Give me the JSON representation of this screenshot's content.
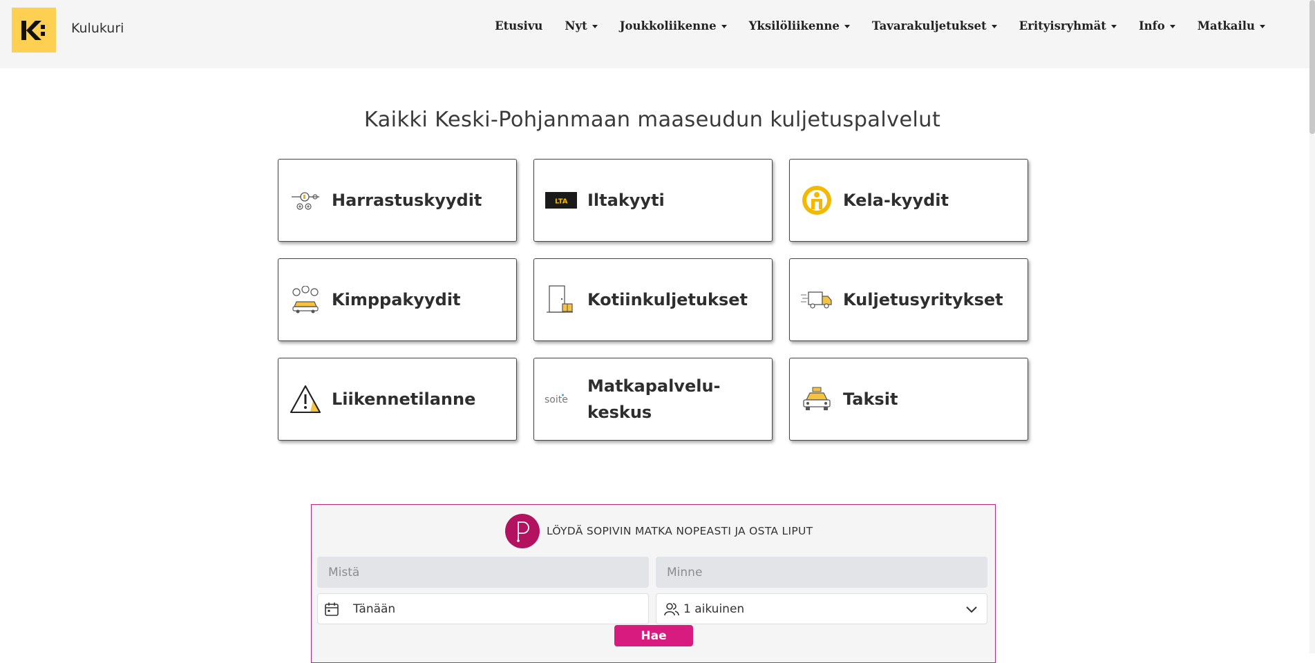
{
  "brand": {
    "name": "Kulukuri",
    "logo_color": "#fdd052"
  },
  "nav": {
    "items": [
      {
        "label": "Etusivu",
        "dropdown": false
      },
      {
        "label": "Nyt",
        "dropdown": true
      },
      {
        "label": "Joukkoliikenne",
        "dropdown": true
      },
      {
        "label": "Yksilöliikenne",
        "dropdown": true
      },
      {
        "label": "Tavarakuljetukset",
        "dropdown": true
      },
      {
        "label": "Erityisryhmät",
        "dropdown": true
      },
      {
        "label": "Info",
        "dropdown": true
      },
      {
        "label": "Matkailu",
        "dropdown": true
      }
    ]
  },
  "main": {
    "title": "Kaikki Keski-Pohjanmaan maaseudun kuljetuspalvelut",
    "tiles": [
      {
        "label": "Harrastuskyydit",
        "icon": "bicycle-music-icon"
      },
      {
        "label": "Iltakyyti",
        "icon": "lta-logo-icon"
      },
      {
        "label": "Kela-kyydit",
        "icon": "kela-icon"
      },
      {
        "label": "Kimppakyydit",
        "icon": "carpool-icon"
      },
      {
        "label": "Kotiinkuljetukset",
        "icon": "door-package-icon"
      },
      {
        "label": "Kuljetusyritykset",
        "icon": "delivery-truck-icon"
      },
      {
        "label": "Liikennetilanne",
        "icon": "warning-icon"
      },
      {
        "label": "Matkapalvelu-keskus",
        "label_line1": "Matkapalvelu-",
        "label_line2": "keskus",
        "icon": "soite-logo-icon"
      },
      {
        "label": "Taksit",
        "icon": "taxi-icon"
      }
    ]
  },
  "widget": {
    "title": "LÖYDÄ SOPIVIN MATKA NOPEASTI JA OSTA LIPUT",
    "from_placeholder": "Mistä",
    "to_placeholder": "Minne",
    "date_value": "Tänään",
    "passengers_value": "1 aikuinen",
    "search_label": "Hae",
    "accent_color": "#d81b7f",
    "logo_text": "LTA",
    "soite_text": "soite"
  }
}
